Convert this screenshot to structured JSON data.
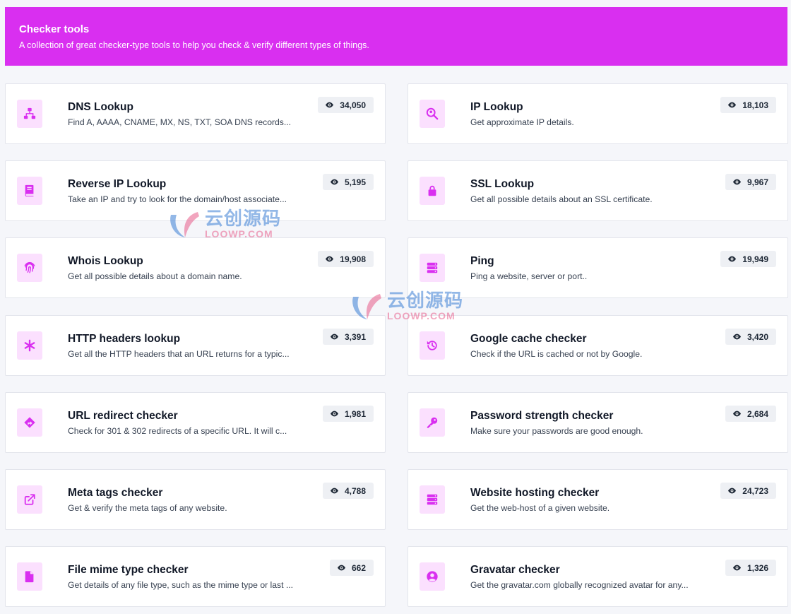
{
  "header": {
    "title": "Checker tools",
    "subtitle": "A collection of great checker-type tools to help you check & verify different types of things."
  },
  "colors": {
    "accent": "#d92ff0",
    "icon_bg": "#fbe0fe"
  },
  "cards": [
    {
      "title": "DNS Lookup",
      "desc": "Find A, AAAA, CNAME, MX, NS, TXT, SOA DNS records...",
      "views": "34,050",
      "icon": "sitemap-icon"
    },
    {
      "title": "IP Lookup",
      "desc": "Get approximate IP details.",
      "views": "18,103",
      "icon": "search-location-icon"
    },
    {
      "title": "Reverse IP Lookup",
      "desc": "Take an IP and try to look for the domain/host associate...",
      "views": "5,195",
      "icon": "book-icon"
    },
    {
      "title": "SSL Lookup",
      "desc": "Get all possible details about an SSL certificate.",
      "views": "9,967",
      "icon": "lock-icon"
    },
    {
      "title": "Whois Lookup",
      "desc": "Get all possible details about a domain name.",
      "views": "19,908",
      "icon": "fingerprint-icon"
    },
    {
      "title": "Ping",
      "desc": "Ping a website, server or port..",
      "views": "19,949",
      "icon": "server-icon"
    },
    {
      "title": "HTTP headers lookup",
      "desc": "Get all the HTTP headers that an URL returns for a typic...",
      "views": "3,391",
      "icon": "asterisk-icon"
    },
    {
      "title": "Google cache checker",
      "desc": "Check if the URL is cached or not by Google.",
      "views": "3,420",
      "icon": "history-icon"
    },
    {
      "title": "URL redirect checker",
      "desc": "Check for 301 & 302 redirects of a specific URL. It will c...",
      "views": "1,981",
      "icon": "directions-icon"
    },
    {
      "title": "Password strength checker",
      "desc": "Make sure your passwords are good enough.",
      "views": "2,684",
      "icon": "key-icon"
    },
    {
      "title": "Meta tags checker",
      "desc": "Get & verify the meta tags of any website.",
      "views": "4,788",
      "icon": "external-link-icon"
    },
    {
      "title": "Website hosting checker",
      "desc": "Get the web-host of a given website.",
      "views": "24,723",
      "icon": "server-icon"
    },
    {
      "title": "File mime type checker",
      "desc": "Get details of any file type, such as the mime type or last ...",
      "views": "662",
      "icon": "file-icon"
    },
    {
      "title": "Gravatar checker",
      "desc": "Get the gravatar.com globally recognized avatar for any...",
      "views": "1,326",
      "icon": "user-circle-icon"
    }
  ],
  "watermark": {
    "cn": "云创源码",
    "en": "LOOWP.COM"
  }
}
